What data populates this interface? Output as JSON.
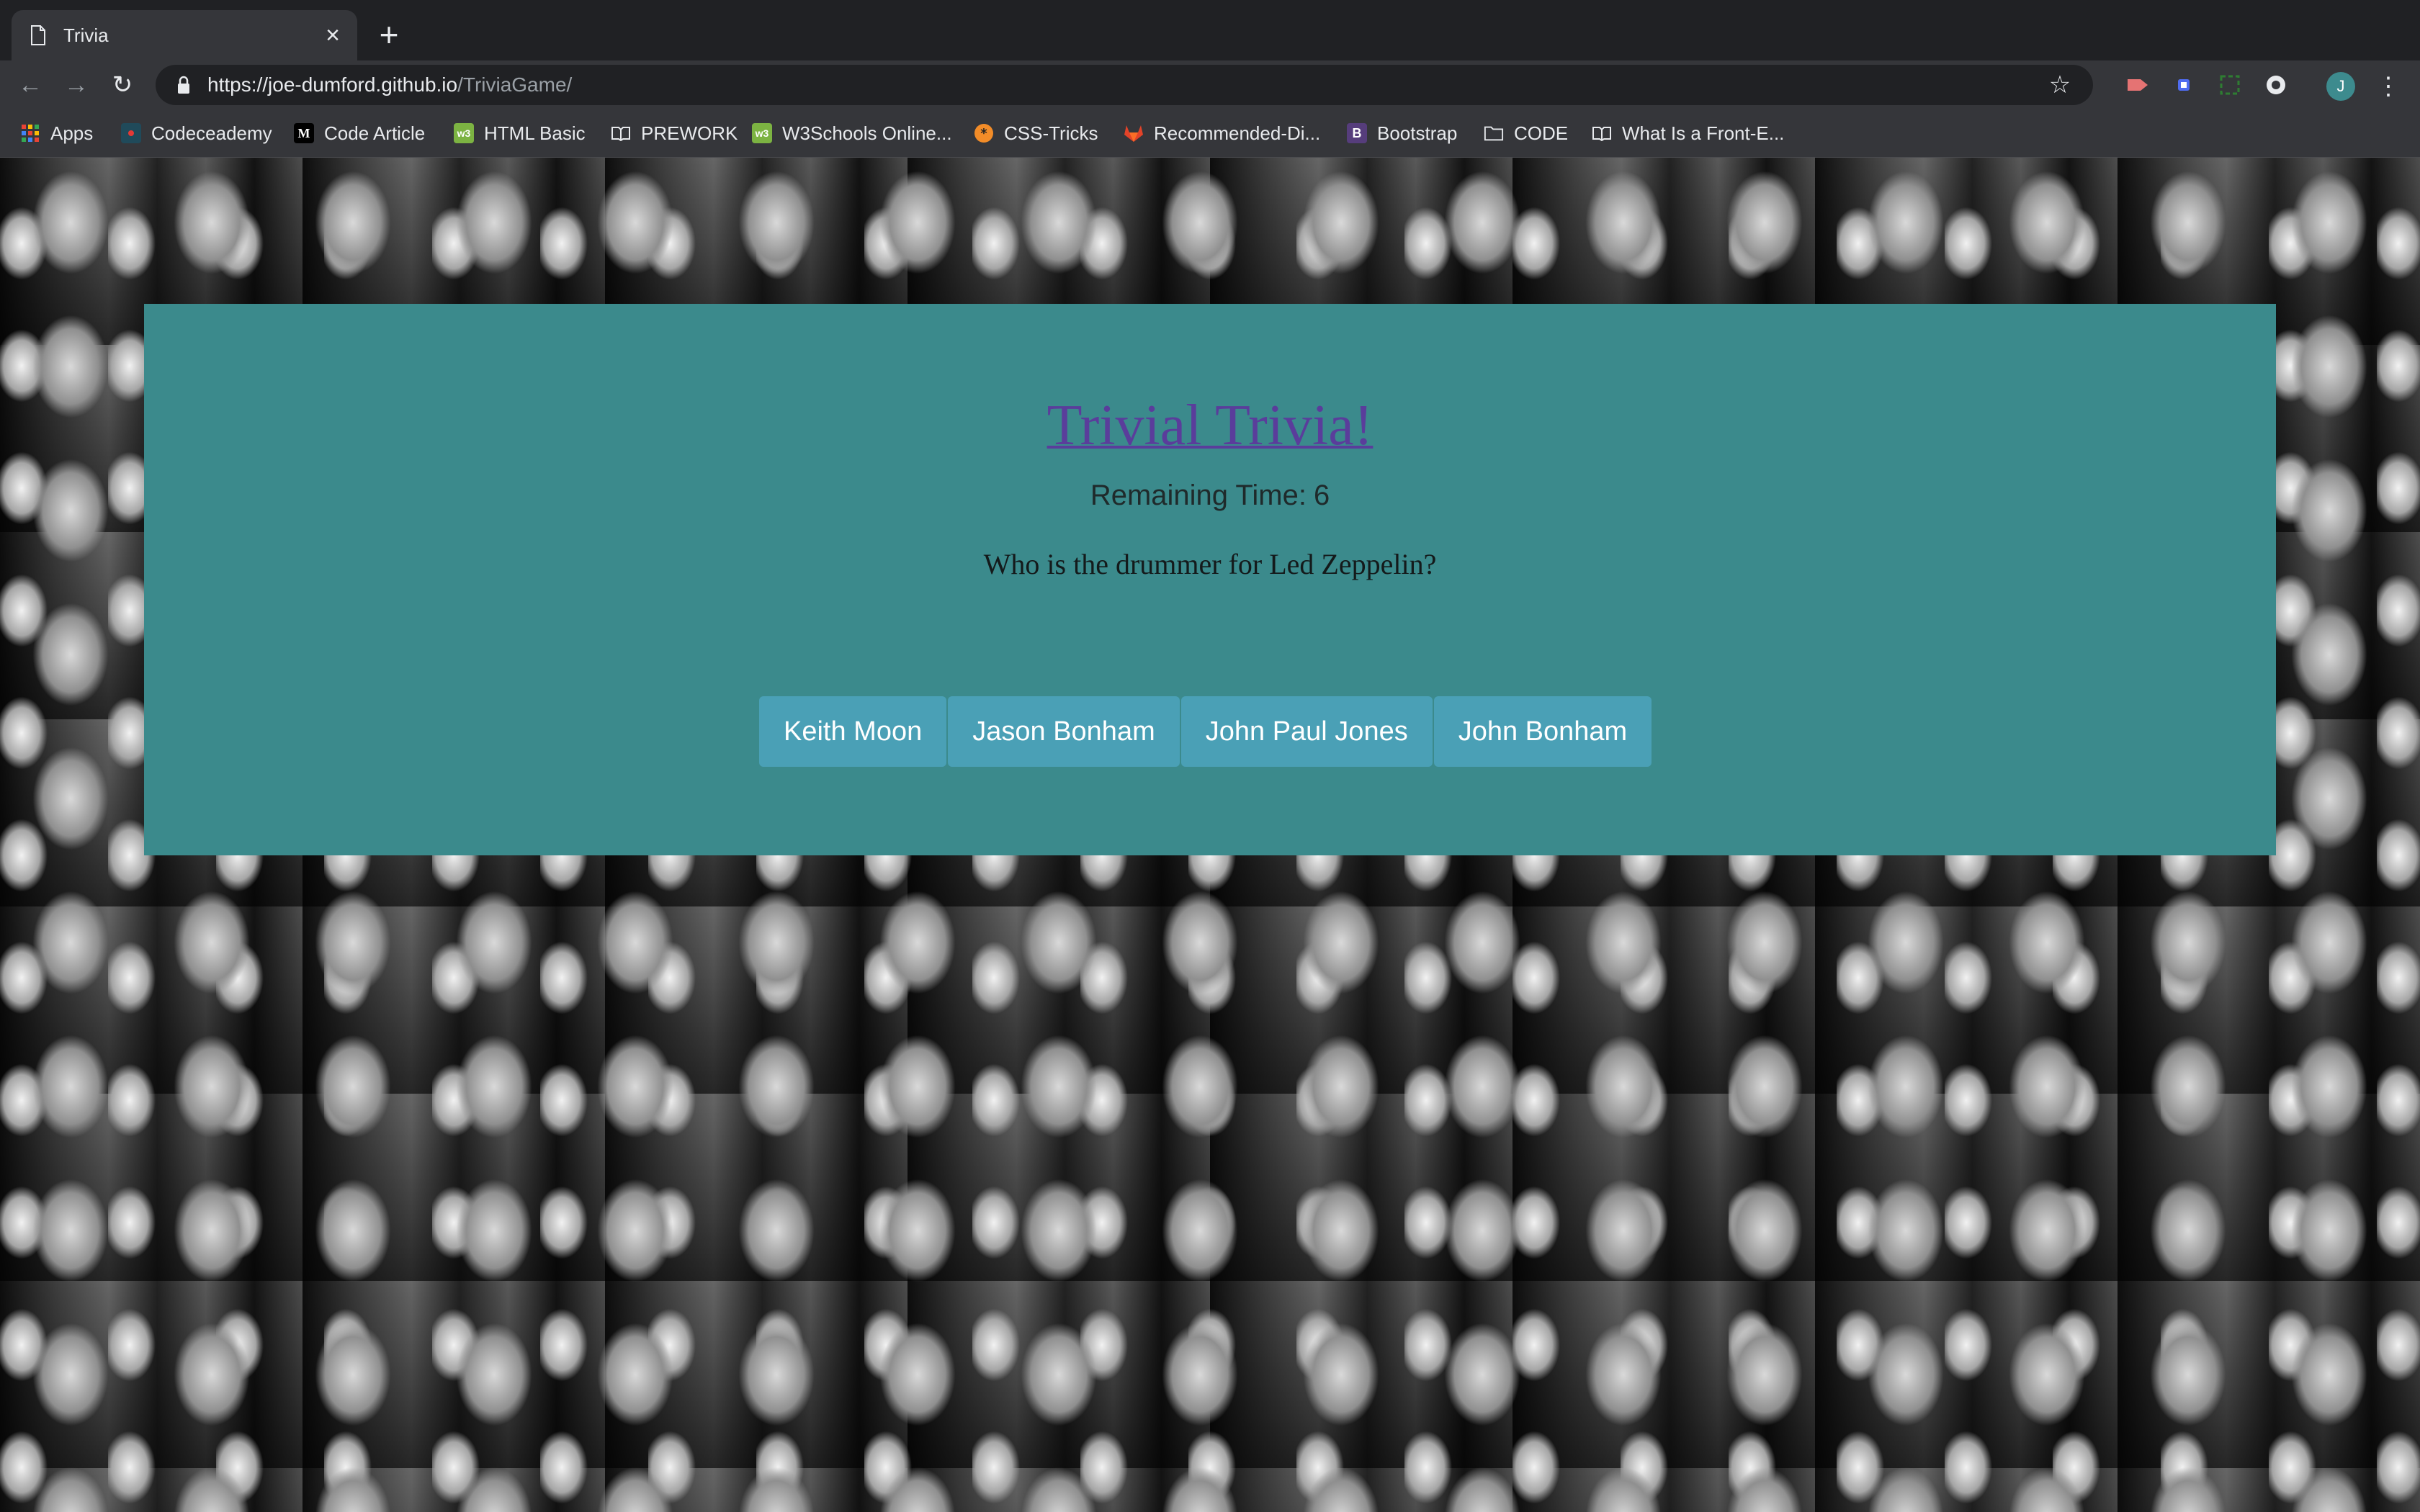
{
  "browser": {
    "tab": {
      "title": "Trivia"
    },
    "url": {
      "host": "https://joe-dumford.github.io",
      "path": "/TriviaGame/"
    },
    "profile_initial": "J",
    "bookmarks": [
      {
        "label": "Apps",
        "icon": "apps-grid-icon"
      },
      {
        "label": "Codeceademy",
        "icon": "codecademy-icon"
      },
      {
        "label": "Code Article",
        "icon": "medium-icon",
        "icon_text": "M"
      },
      {
        "label": "HTML Basic",
        "icon": "w3schools-icon",
        "icon_text": "w3"
      },
      {
        "label": "PREWORK",
        "icon": "reader-icon"
      },
      {
        "label": "W3Schools Online...",
        "icon": "w3schools-icon",
        "icon_text": "w3"
      },
      {
        "label": "CSS-Tricks",
        "icon": "css-tricks-icon"
      },
      {
        "label": "Recommended-Di...",
        "icon": "gitlab-icon"
      },
      {
        "label": "Bootstrap",
        "icon": "bootstrap-icon",
        "icon_text": "B"
      },
      {
        "label": "CODE",
        "icon": "folder-icon"
      },
      {
        "label": "What Is a Front-E...",
        "icon": "reader-icon"
      }
    ]
  },
  "game": {
    "title": "Trivial Trivia!",
    "remaining_label": "Remaining Time:",
    "remaining_value": "6",
    "question": "Who is the drummer for Led Zeppelin?",
    "answers": [
      "Keith Moon",
      "Jason Bonham",
      "John Paul Jones",
      "John Bonham"
    ]
  },
  "colors": {
    "panel": "#3b8a8c",
    "title_link": "#5a3d9b",
    "answer_button": "#4aa0b6"
  }
}
